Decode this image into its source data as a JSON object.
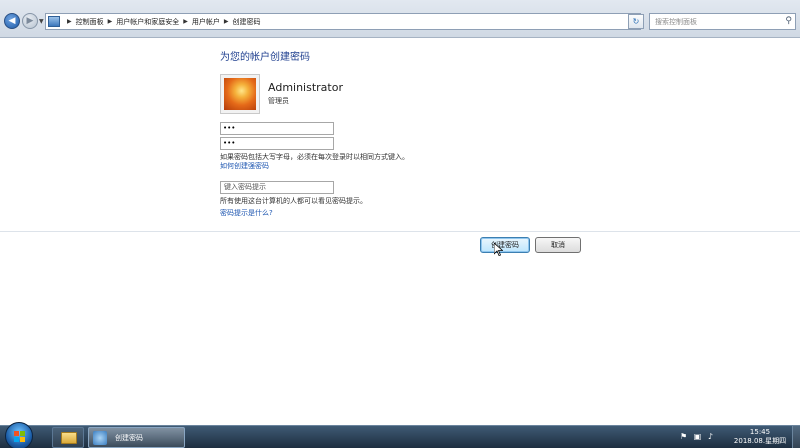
{
  "window": {
    "minimize_glyph": "—",
    "maximize_glyph": "□",
    "close_glyph": "✕"
  },
  "addressbar": {
    "breadcrumbs": [
      "控制面板",
      "用户帐户和家庭安全",
      "用户帐户",
      "创建密码"
    ],
    "search_placeholder": "搜索控制面板",
    "back_glyph": "◀",
    "forward_glyph": "▶",
    "refresh_glyph": "↻",
    "search_glyph": "⚲"
  },
  "page": {
    "heading": "为您的帐户创建密码",
    "user_name": "Administrator",
    "user_role": "管理员",
    "password_value": "•••",
    "confirm_value": "•••",
    "caps_note": "如果密码包括大写字母，必须在每次登录时以相同方式键入。",
    "link_strong_password": "如何创建强密码",
    "hint_placeholder": "键入密码提示",
    "hint_note": "所有使用这台计算机的人都可以看见密码提示。",
    "link_hint_what": "密码提示是什么?",
    "create_button": "创建密码",
    "cancel_button": "取消"
  },
  "taskbar": {
    "active_task_label": "创建密码",
    "time": "15:45",
    "date": "2018.08.星期四",
    "tray_icons": [
      "flag-icon",
      "network-icon",
      "volume-icon"
    ]
  }
}
